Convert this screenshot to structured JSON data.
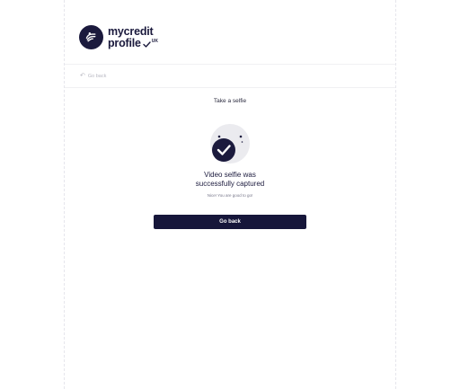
{
  "brand": {
    "name_line1": "mycredit",
    "name_line2": "profile",
    "badge": "UK"
  },
  "nav": {
    "back_label": "Go back"
  },
  "main": {
    "title": "Take a selfie",
    "headline_line1": "Video selfie was",
    "headline_line2": "successfully captured",
    "subtext": "Nice! You are good to go!",
    "button_label": "Go back"
  },
  "colors": {
    "primary": "#16163a",
    "illustration_bg": "#ebebef",
    "muted_text": "#b8b8c2"
  },
  "icons": [
    "logo-hand-icon",
    "back-arrow-icon",
    "selfie-success-icon",
    "checkmark-icon"
  ]
}
